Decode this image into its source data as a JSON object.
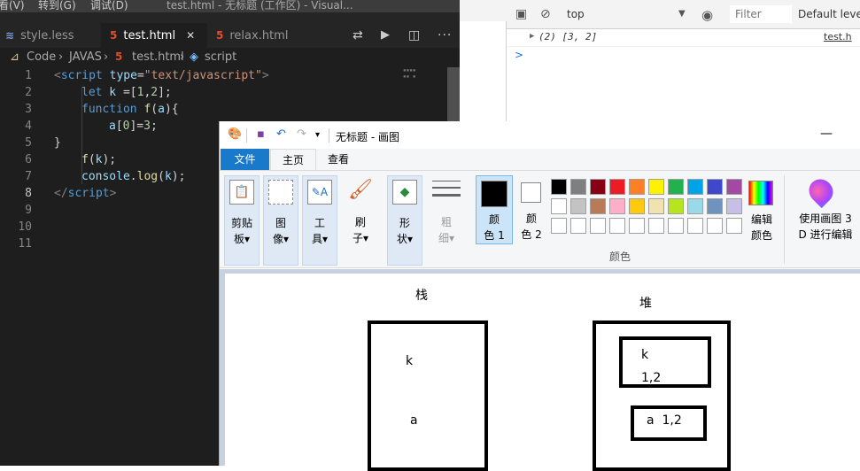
{
  "vscode": {
    "menu_view": "看(V)",
    "menu_goto": "转到(G)",
    "menu_debug": "调试(D)",
    "window_title": "test.html - 无标题 (工作区) - Visual...",
    "tabs": [
      {
        "label": "style.less",
        "icon": "css-file-icon"
      },
      {
        "label": "test.html",
        "icon": "html5-file-icon"
      },
      {
        "label": "relax.html",
        "icon": "html5-file-icon"
      }
    ],
    "breadcrumb": {
      "root": "Code",
      "folder": "JAVAS",
      "file": "test.html",
      "symbol": "script"
    },
    "line_numbers": [
      "1",
      "2",
      "3",
      "4",
      "5",
      "6",
      "7",
      "8",
      "9",
      "10",
      "11"
    ],
    "code": {
      "l1_open": "<",
      "l1_tag": "script",
      "l1_attr": " type",
      "l1_eq": "=",
      "l1_str": "\"text/javascript\"",
      "l1_close": ">",
      "l2_kw": "let",
      "l2_var": " k ",
      "l2_rest": "=[",
      "l2_n1": "1",
      "l2_c": ",",
      "l2_n2": "2",
      "l2_end": "];",
      "l3_kw": "function",
      "l3_fn": " f",
      "l3_p1": "(",
      "l3_var": "a",
      "l3_p2": "){",
      "l4_var": "a",
      "l4_b1": "[",
      "l4_n0": "0",
      "l4_b2": "]=",
      "l4_n3": "3",
      "l4_end": ";",
      "l5": "}",
      "l6_fn": "f",
      "l6_p1": "(",
      "l6_var": "k",
      "l6_end": ");",
      "l7_var": "console",
      "l7_dot": ".",
      "l7_fn": "log",
      "l7_p1": "(",
      "l7_var2": "k",
      "l7_end": ");",
      "l8_open": "</",
      "l8_tag": "script",
      "l8_close": ">"
    }
  },
  "devtools": {
    "context": "top",
    "filter_placeholder": "Filter",
    "levels": "Default levels",
    "log_value": "(2) [3, 2]",
    "log_source": "test.h",
    "prompt": ">"
  },
  "paint": {
    "title": "无标题 - 画图",
    "tabs": {
      "file": "文件",
      "home": "主页",
      "view": "查看"
    },
    "ribbon": {
      "clipboard": [
        "剪贴",
        "板"
      ],
      "image": [
        "图",
        "像"
      ],
      "tools": [
        "工",
        "具"
      ],
      "brushes": [
        "刷",
        "子"
      ],
      "shapes": [
        "形",
        "状"
      ],
      "size": [
        "粗",
        "细"
      ],
      "color1": [
        "颜",
        "色 1"
      ],
      "color2": [
        "颜",
        "色 2"
      ],
      "edit_colors": [
        "编辑",
        "颜色"
      ],
      "paint3d": [
        "使用画图 3",
        "D 进行编辑"
      ],
      "colors_group": "颜色"
    },
    "palette_row1": [
      "#000000",
      "#7f7f7f",
      "#880015",
      "#ed1c24",
      "#ff7f27",
      "#fff200",
      "#22b14c",
      "#00a2e8",
      "#3f48cc",
      "#a349a4"
    ],
    "palette_row2": [
      "#ffffff",
      "#c3c3c3",
      "#b97a57",
      "#ffaec9",
      "#ffc90e",
      "#efe4b0",
      "#b5e61d",
      "#99d9ea",
      "#7092be",
      "#c8bfe7"
    ],
    "canvas": {
      "stack_label": "栈",
      "heap_label": "堆",
      "stack_k": "k",
      "stack_a": "a",
      "heap_k": "k",
      "heap_k_val": "1,2",
      "heap_a": "a  1,2"
    }
  }
}
